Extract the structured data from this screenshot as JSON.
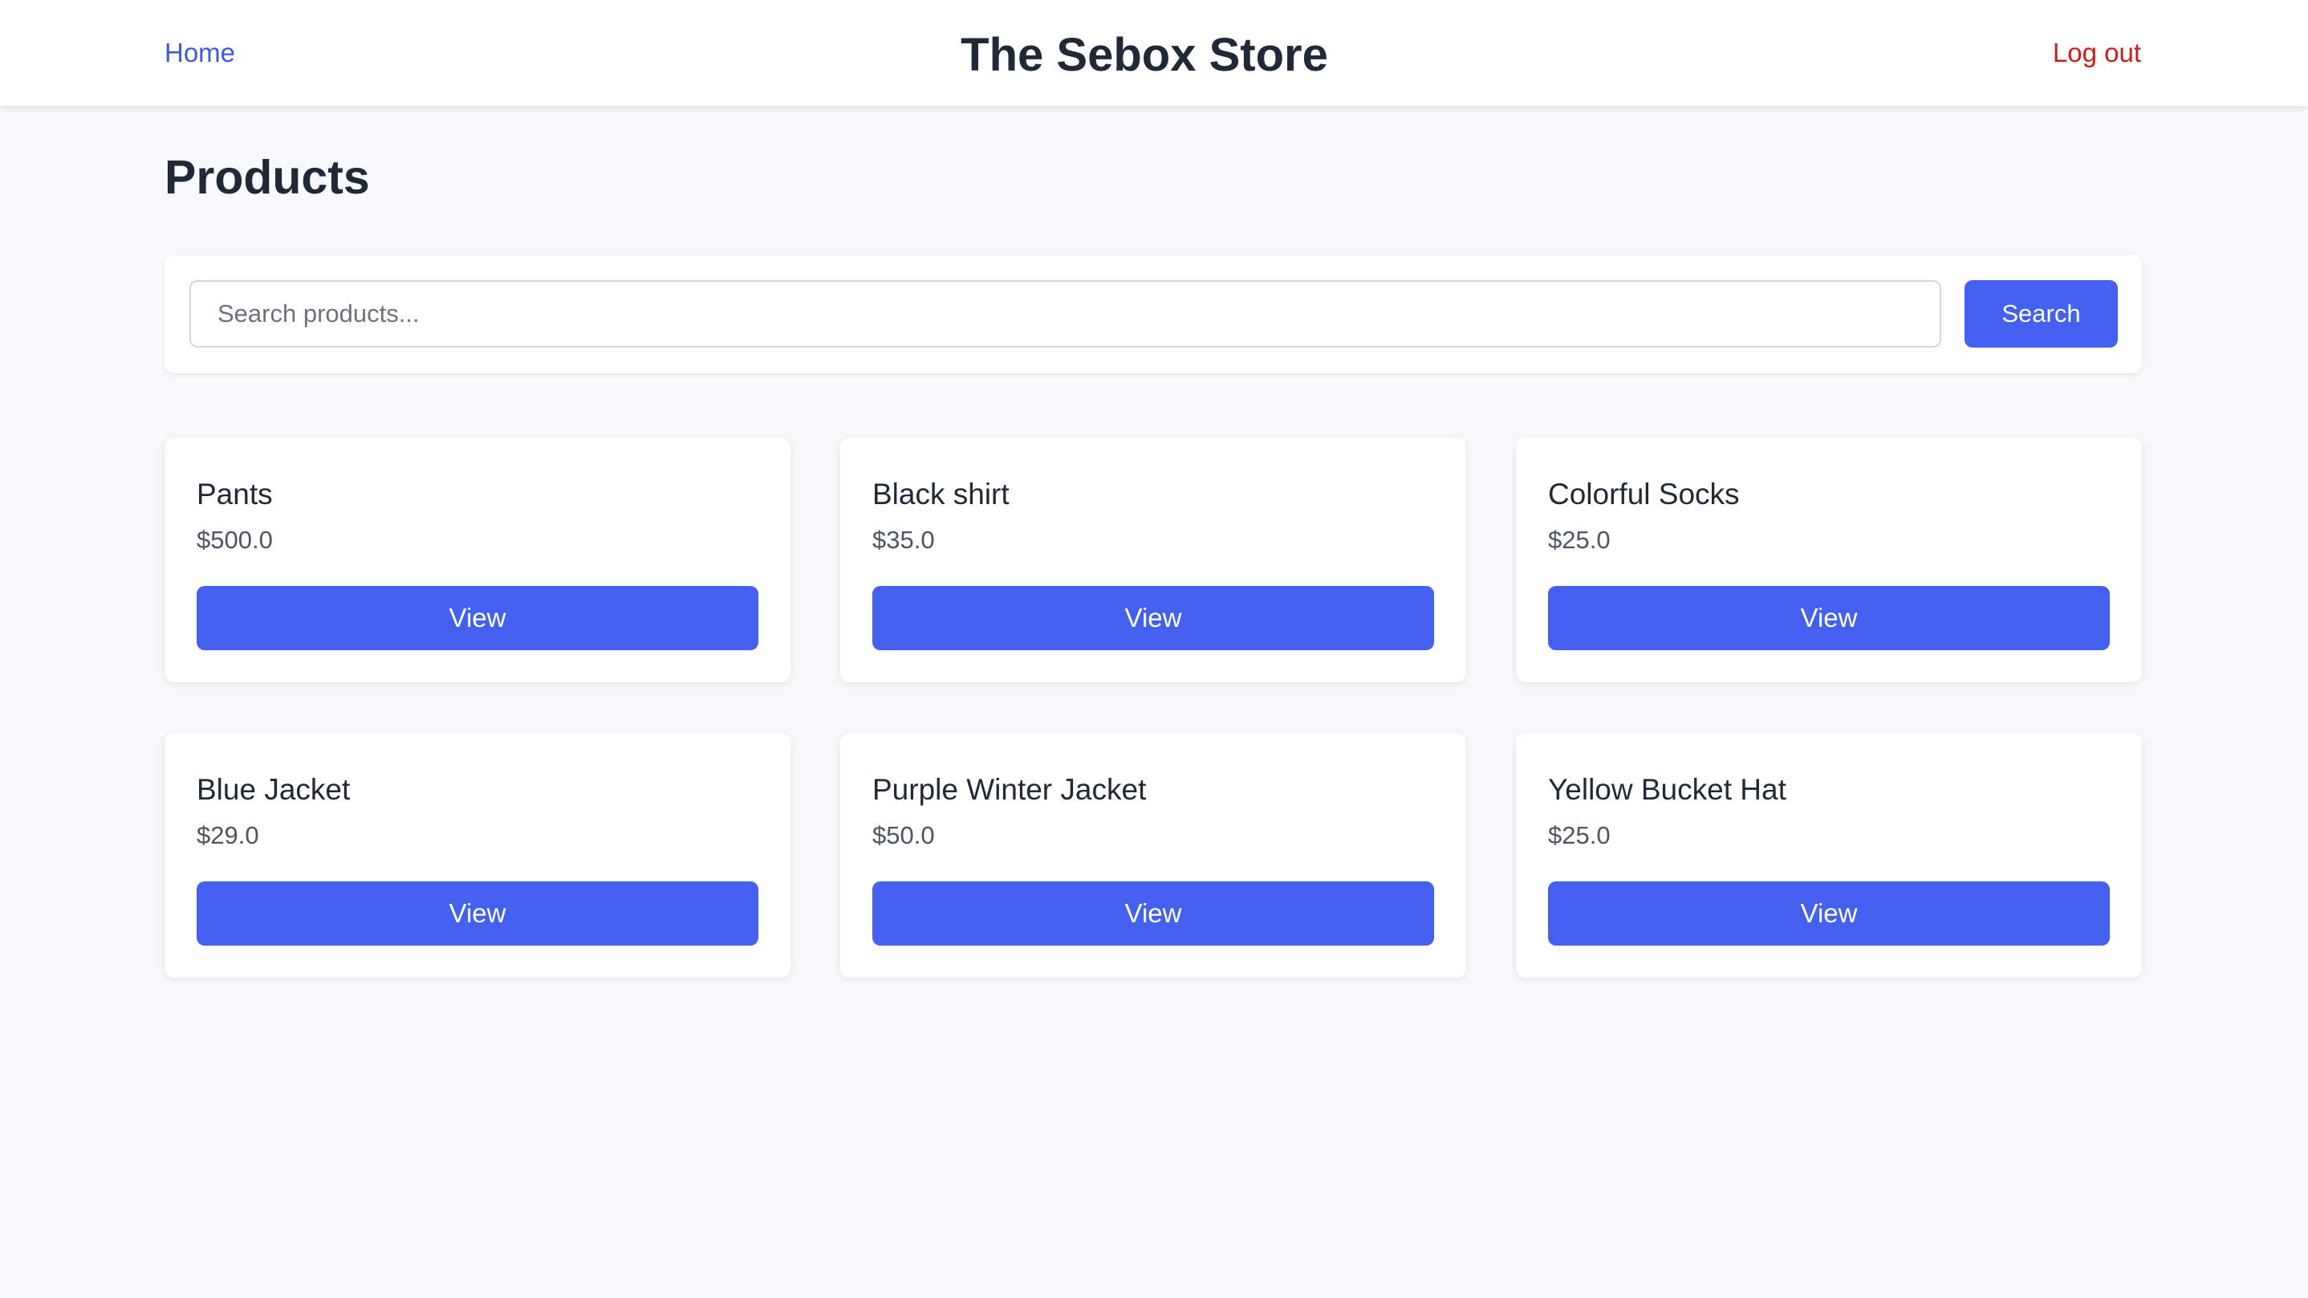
{
  "nav": {
    "home_label": "Home",
    "site_title": "The Sebox Store",
    "logout_label": "Log out"
  },
  "main": {
    "heading": "Products",
    "search": {
      "placeholder": "Search products...",
      "value": "",
      "button_label": "Search"
    },
    "products": [
      {
        "name": "Pants",
        "price": "$500.0",
        "action_label": "View"
      },
      {
        "name": "Black shirt",
        "price": "$35.0",
        "action_label": "View"
      },
      {
        "name": "Colorful Socks",
        "price": "$25.0",
        "action_label": "View"
      },
      {
        "name": "Blue Jacket",
        "price": "$29.0",
        "action_label": "View"
      },
      {
        "name": "Purple Winter Jacket",
        "price": "$50.0",
        "action_label": "View"
      },
      {
        "name": "Yellow Bucket Hat",
        "price": "$25.0",
        "action_label": "View"
      }
    ]
  },
  "colors": {
    "accent": "#4361ee",
    "link": "#3b5bdb",
    "logout": "#c81e1e",
    "background": "#f8f9fb"
  }
}
